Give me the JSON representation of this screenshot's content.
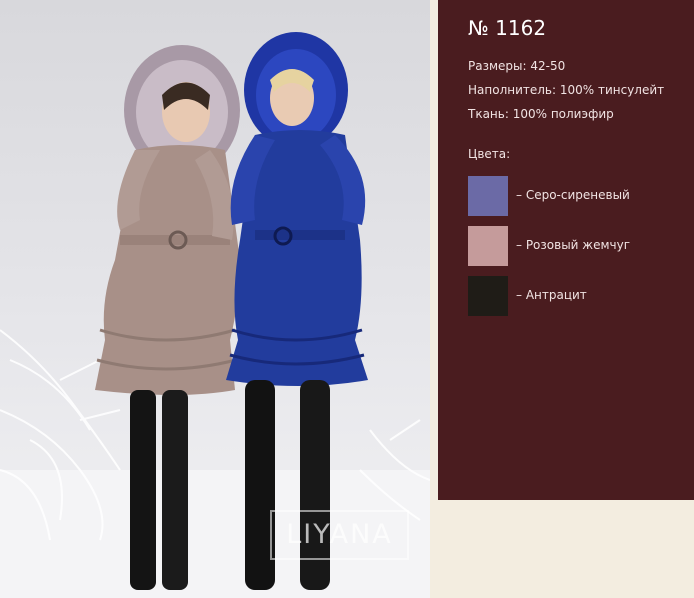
{
  "photo": {
    "watermark": "LIYANA"
  },
  "product": {
    "model": "№ 1162",
    "sizes": "Размеры: 42-50",
    "filling": "Наполнитель: 100% тинсулейт",
    "fabric": "Ткань: 100% полиэфир",
    "colors_title": "Цвета:",
    "colors": [
      {
        "label": "– Серо-сиреневый",
        "hex": "#6b6aa6"
      },
      {
        "label": "– Розовый жемчуг",
        "hex": "#c59b9b"
      },
      {
        "label": "– Антрацит",
        "hex": "#1f1c17"
      }
    ]
  },
  "theme": {
    "panel_bg": "#4a1c1f",
    "page_bg": "#f3ede0"
  }
}
